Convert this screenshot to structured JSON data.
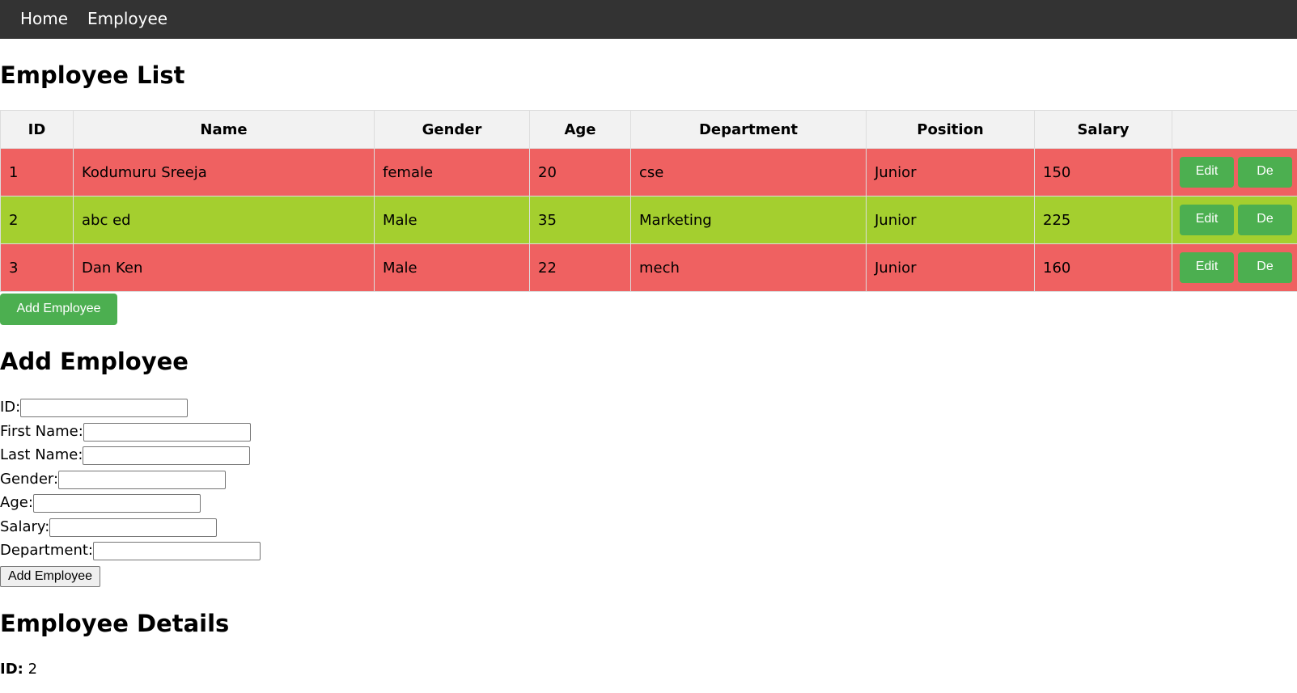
{
  "nav": {
    "home": "Home",
    "employee": "Employee"
  },
  "list": {
    "title": "Employee List",
    "columns": [
      "ID",
      "Name",
      "Gender",
      "Age",
      "Department",
      "Position",
      "Salary",
      ""
    ],
    "rows": [
      {
        "id": "1",
        "name": "Kodumuru Sreeja",
        "gender": "female",
        "age": "20",
        "department": "cse",
        "position": "Junior",
        "salary": "150",
        "edit": "Edit",
        "delete": "De",
        "color": "#ef6161"
      },
      {
        "id": "2",
        "name": "abc ed",
        "gender": "Male",
        "age": "35",
        "department": "Marketing",
        "position": "Junior",
        "salary": "225",
        "edit": "Edit",
        "delete": "De",
        "color": "#a4cf2f"
      },
      {
        "id": "3",
        "name": "Dan Ken",
        "gender": "Male",
        "age": "22",
        "department": "mech",
        "position": "Junior",
        "salary": "160",
        "edit": "Edit",
        "delete": "De",
        "color": "#ef6161"
      }
    ],
    "add_button": "Add Employee"
  },
  "form": {
    "title": "Add Employee",
    "fields": [
      {
        "label": "ID:",
        "value": ""
      },
      {
        "label": "First Name:",
        "value": ""
      },
      {
        "label": "Last Name:",
        "value": ""
      },
      {
        "label": "Gender:",
        "value": ""
      },
      {
        "label": "Age:",
        "value": ""
      },
      {
        "label": "Salary:",
        "value": ""
      },
      {
        "label": "Department:",
        "value": ""
      }
    ],
    "submit": "Add Employee"
  },
  "details": {
    "title": "Employee Details",
    "id_label": "ID:",
    "id_value": "2"
  },
  "colors": {
    "navbar": "#333333",
    "header_bg": "#f2f2f2",
    "button_green": "#4caf50",
    "row_red": "#ef6161",
    "row_green": "#a4cf2f"
  }
}
